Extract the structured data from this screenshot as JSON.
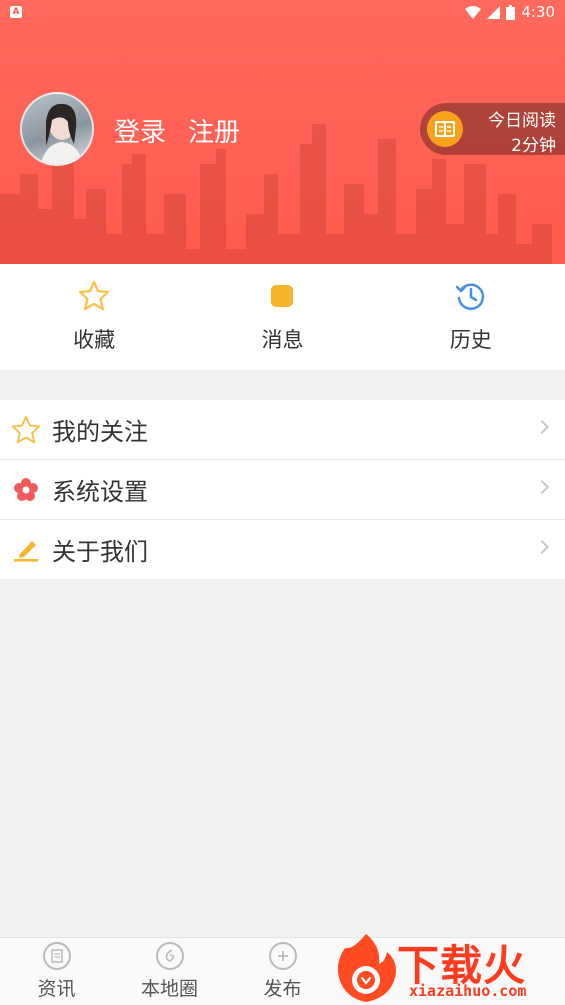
{
  "status_bar": {
    "time": "4:30"
  },
  "profile": {
    "login_label": "登录",
    "register_label": "注册"
  },
  "reading": {
    "title": "今日阅读",
    "duration": "2分钟"
  },
  "quick_actions": [
    {
      "label": "收藏",
      "icon": "star-icon"
    },
    {
      "label": "消息",
      "icon": "message-icon"
    },
    {
      "label": "历史",
      "icon": "history-icon"
    }
  ],
  "menu": [
    {
      "label": "我的关注",
      "icon": "star-outline-icon"
    },
    {
      "label": "系统设置",
      "icon": "flower-gear-icon"
    },
    {
      "label": "关于我们",
      "icon": "pen-edit-icon"
    }
  ],
  "tabbar": [
    {
      "label": "资讯",
      "icon": "news-icon"
    },
    {
      "label": "本地圈",
      "icon": "local-circle-icon"
    },
    {
      "label": "发布",
      "icon": "plus-icon"
    }
  ],
  "watermark": {
    "title": "下载火",
    "url": "xiazaihuo.com"
  },
  "colors": {
    "header": "#ff5a4e",
    "accent_orange": "#f7a21b",
    "star": "#f8c14a",
    "history_blue": "#4a90e2",
    "settings_red": "#f25a5a"
  }
}
